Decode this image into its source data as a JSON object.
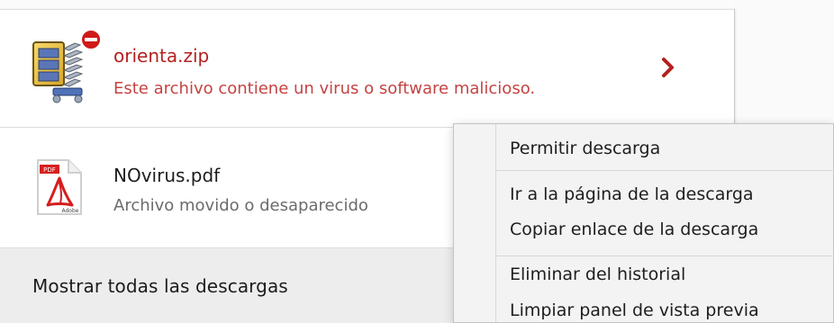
{
  "downloads": {
    "items": [
      {
        "file_name": "orienta.zip",
        "status_text": "Este archivo contiene un virus o software malicioso.",
        "icon": "zip-file-blocked-icon",
        "status_color": "#c54343"
      },
      {
        "file_name": "NOvirus.pdf",
        "status_text": "Archivo movido o desaparecido",
        "icon": "pdf-file-icon"
      }
    ],
    "footer_label": "Mostrar todas las descargas"
  },
  "context_menu": {
    "items": [
      {
        "label": "Permitir descarga"
      },
      {
        "label": "Ir a la página de la descarga"
      },
      {
        "label": "Copiar enlace de la descarga"
      },
      {
        "label": "Eliminar del historial"
      },
      {
        "label": "Limpiar panel de vista previa"
      }
    ]
  },
  "colors": {
    "danger_red": "#b51f1f",
    "text_gray": "#5c5c5c",
    "menu_bg": "#f3f3f3"
  }
}
